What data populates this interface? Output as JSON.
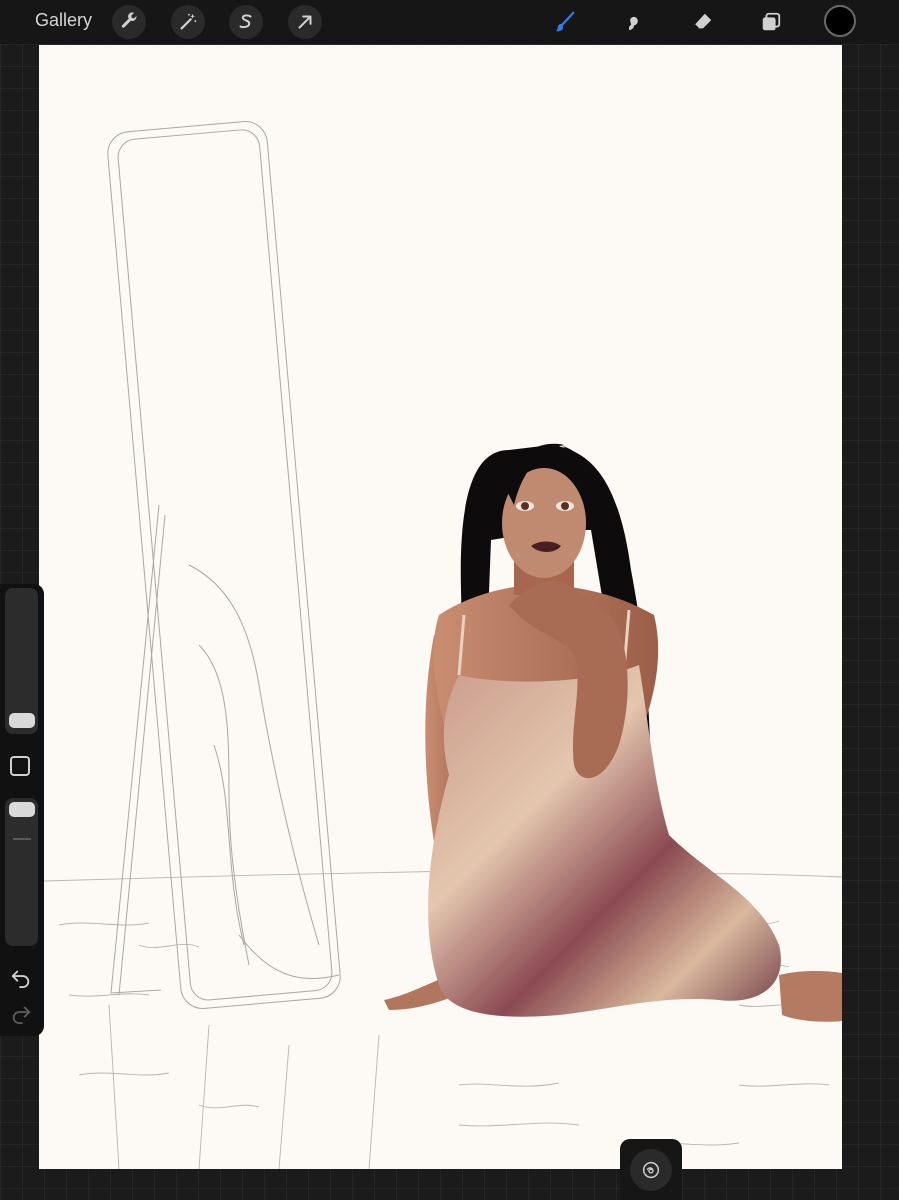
{
  "toolbar": {
    "gallery_label": "Gallery",
    "left_tools": [
      "wrench-icon",
      "magic-wand-icon",
      "selection-s-icon",
      "transform-arrow-icon"
    ],
    "right_tools": [
      "brush-icon",
      "smudge-icon",
      "eraser-icon",
      "layers-icon"
    ],
    "active_tool": "brush-icon",
    "active_color": "#2f7df6",
    "current_color": "#000000"
  },
  "sidebar": {
    "brush_size_level": 0.1,
    "opacity_level": 1.0,
    "items": [
      "brush-size-slider",
      "modify-button",
      "opacity-slider",
      "undo-icon",
      "redo-icon"
    ]
  },
  "canvas": {
    "background_color": "#fdf9f5",
    "subject": "woman-in-satin-slip-dress",
    "sketch": "standing-mirror-line-art"
  },
  "quick_menu": {
    "icon": "quickshape-icon"
  }
}
